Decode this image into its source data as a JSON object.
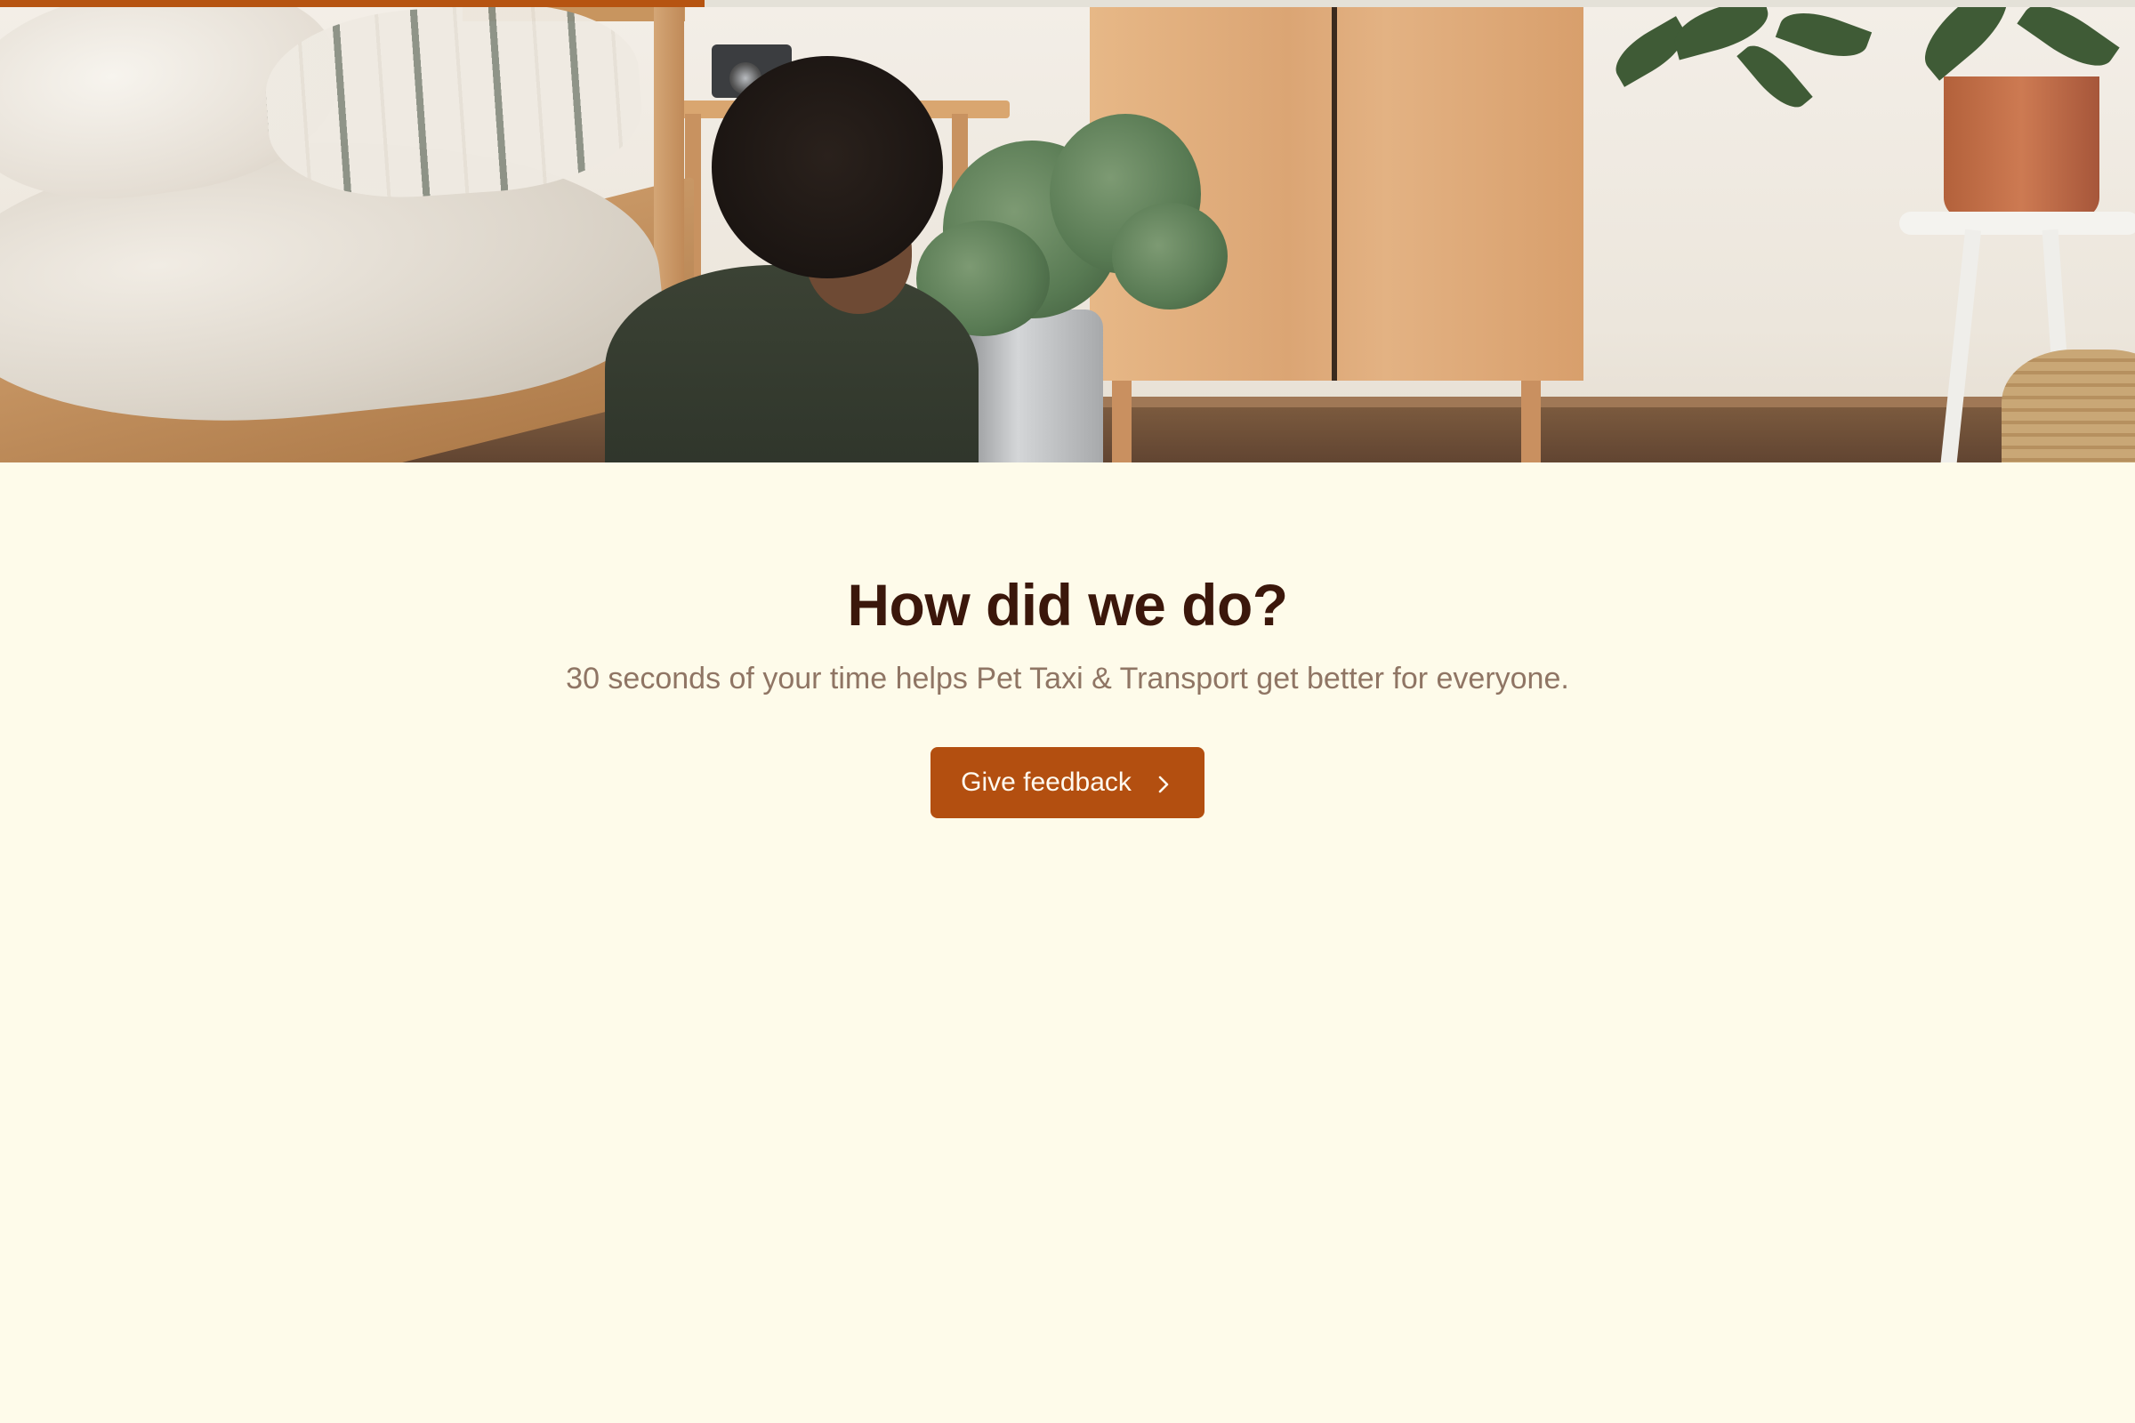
{
  "progress": {
    "percent_complete": 33
  },
  "hero": {
    "image": "kid-in-bedroom-photo"
  },
  "survey": {
    "title": "How did we do?",
    "subtitle": "30 seconds of your time helps Pet Taxi & Transport get better for everyone.",
    "cta_label": "Give feedback",
    "cta_icon": "chevron-right-icon"
  },
  "colors": {
    "background": "#fefbea",
    "accent": "#b34f10",
    "title": "#3b170b",
    "subtitle": "#8f7564"
  }
}
